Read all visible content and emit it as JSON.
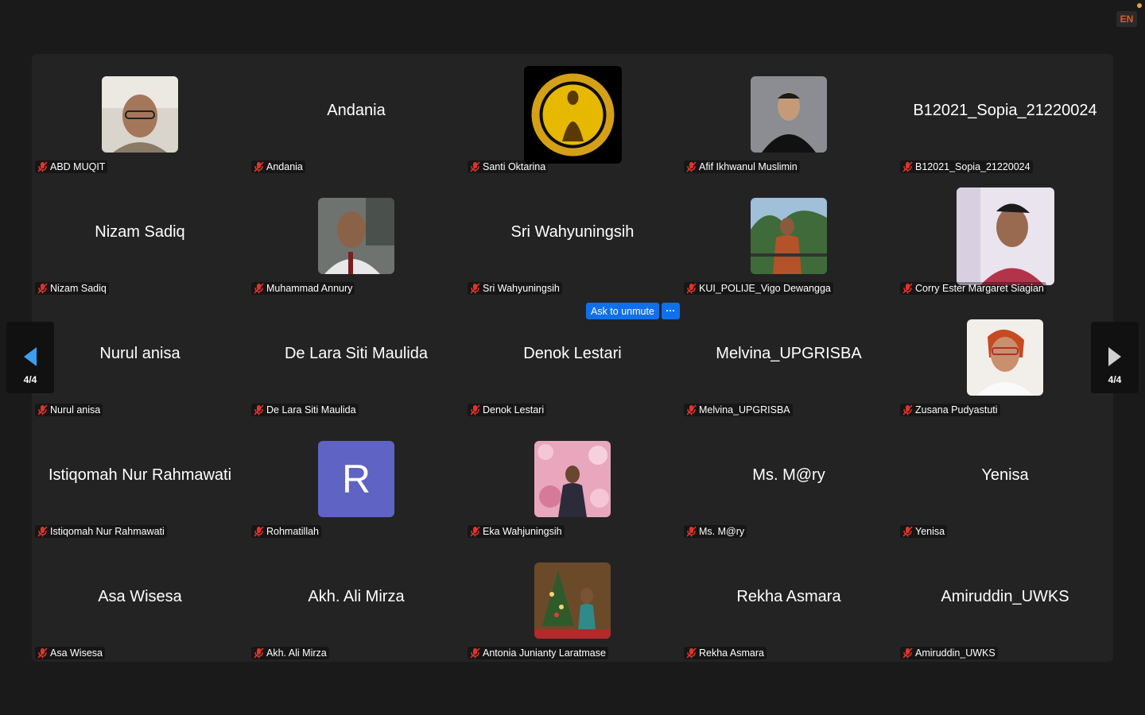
{
  "language_badge": "EN",
  "pager": {
    "left": "4/4",
    "right": "4/4"
  },
  "overlay": {
    "ask_to_unmute": "Ask to unmute",
    "more": "···"
  },
  "colors": {
    "accent_blue": "#0e71eb",
    "mute_red": "#e0342b",
    "avatar_r": "#5f63c4",
    "badge_orange": "#e05a2a"
  },
  "participants": [
    {
      "name": "ABD MUQIT",
      "display": "photo"
    },
    {
      "name": "Andania",
      "display": "name"
    },
    {
      "name": "Santi Oktarina",
      "display": "logo"
    },
    {
      "name": "Afif Ikhwanul Muslimin",
      "display": "photo"
    },
    {
      "name": "B12021_Sopia_21220024",
      "display": "name"
    },
    {
      "name": "Nizam Sadiq",
      "display": "name"
    },
    {
      "name": "Muhammad Annury",
      "display": "photo"
    },
    {
      "name": "Sri Wahyuningsih",
      "display": "name"
    },
    {
      "name": "KUI_POLIJE_Vigo Dewangga",
      "display": "photo"
    },
    {
      "name": "Corry Ester Margaret Siagian",
      "display": "photo"
    },
    {
      "name": "Nurul anisa",
      "display": "name"
    },
    {
      "name": "De Lara Siti Maulida",
      "display": "name"
    },
    {
      "name": "Denok Lestari",
      "display": "name"
    },
    {
      "name": "Melvina_UPGRISBA",
      "display": "name"
    },
    {
      "name": "Zusana Pudyastuti",
      "display": "photo"
    },
    {
      "name": "Istiqomah Nur Rahmawati",
      "display": "name"
    },
    {
      "name": "Rohmatillah",
      "display": "avatar",
      "initial": "R"
    },
    {
      "name": "Eka Wahjuningsih",
      "display": "photo"
    },
    {
      "name": "Ms. M@ry",
      "display": "name"
    },
    {
      "name": "Yenisa",
      "display": "name"
    },
    {
      "name": "Asa Wisesa",
      "display": "name"
    },
    {
      "name": "Akh. Ali Mirza",
      "display": "name"
    },
    {
      "name": "Antonia Junianty Laratmase",
      "display": "photo"
    },
    {
      "name": "Rekha Asmara",
      "display": "name"
    },
    {
      "name": "Amiruddin_UWKS",
      "display": "name"
    }
  ]
}
